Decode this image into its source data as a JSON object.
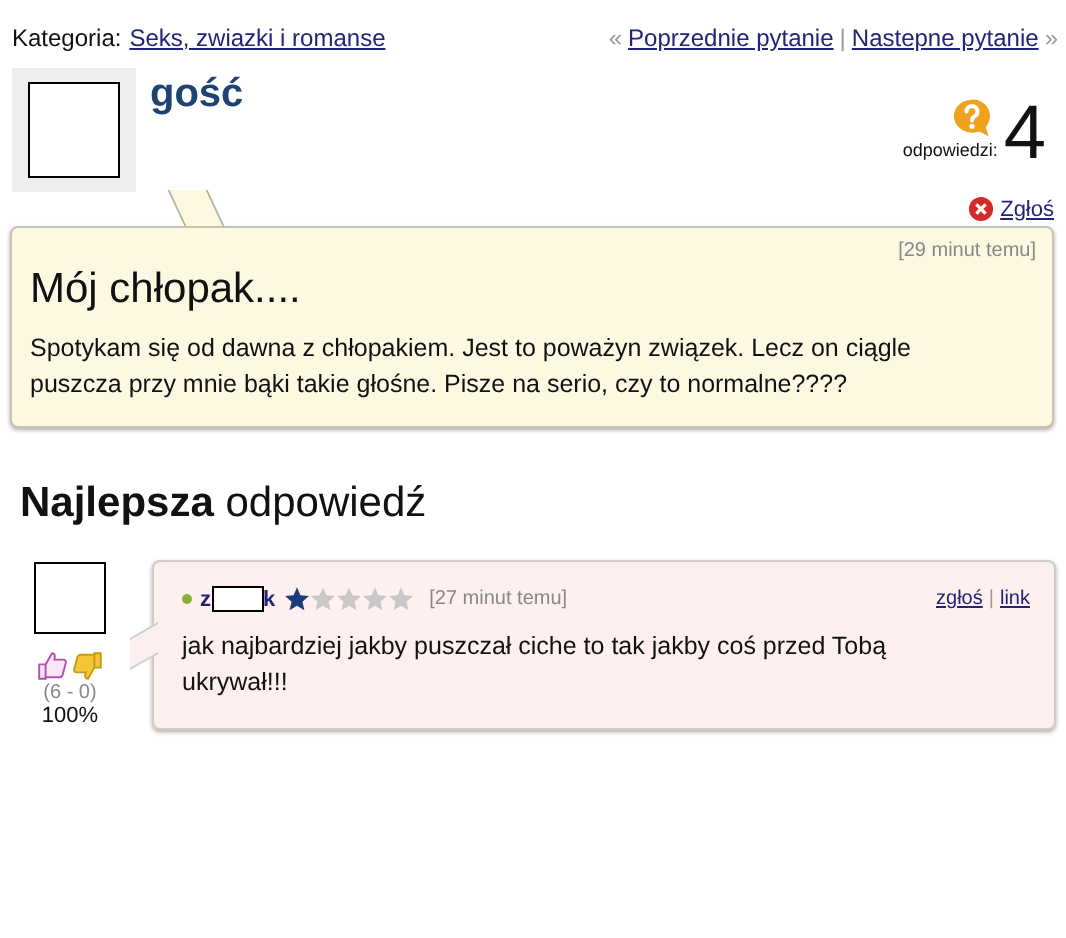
{
  "category": {
    "label": "Kategoria:",
    "link": "Seks, zwiazki i romanse"
  },
  "nav": {
    "prev_mark": "«",
    "prev": "Poprzednie pytanie",
    "separator": "|",
    "next": "Nastepne pytanie",
    "next_mark": "»"
  },
  "question": {
    "author": "gość",
    "answers_label": "odpowiedzi:",
    "answers_count": "4",
    "report": "Zgłoś",
    "time": "[29 minut temu]",
    "title": "Mój chłopak....",
    "body": "Spotykam się od dawna z chłopakiem. Jest to poważyn związek. Lecz on ciągle puszcza przy mnie bąki takie głośne. Pisze na serio, czy to normalne????"
  },
  "best_answer": {
    "heading_bold": "Najlepsza",
    "heading_rest": "odpowiedź",
    "votes": "(6 - 0)",
    "percent": "100%",
    "author_start": "z",
    "author_end": "k",
    "stars": 1,
    "time": "[27 minut temu]",
    "report": "zgłoś",
    "separator": "|",
    "link": "link",
    "body": "jak najbardziej jakby puszczał ciche to tak jakby coś przed Tobą ukrywał!!!"
  }
}
